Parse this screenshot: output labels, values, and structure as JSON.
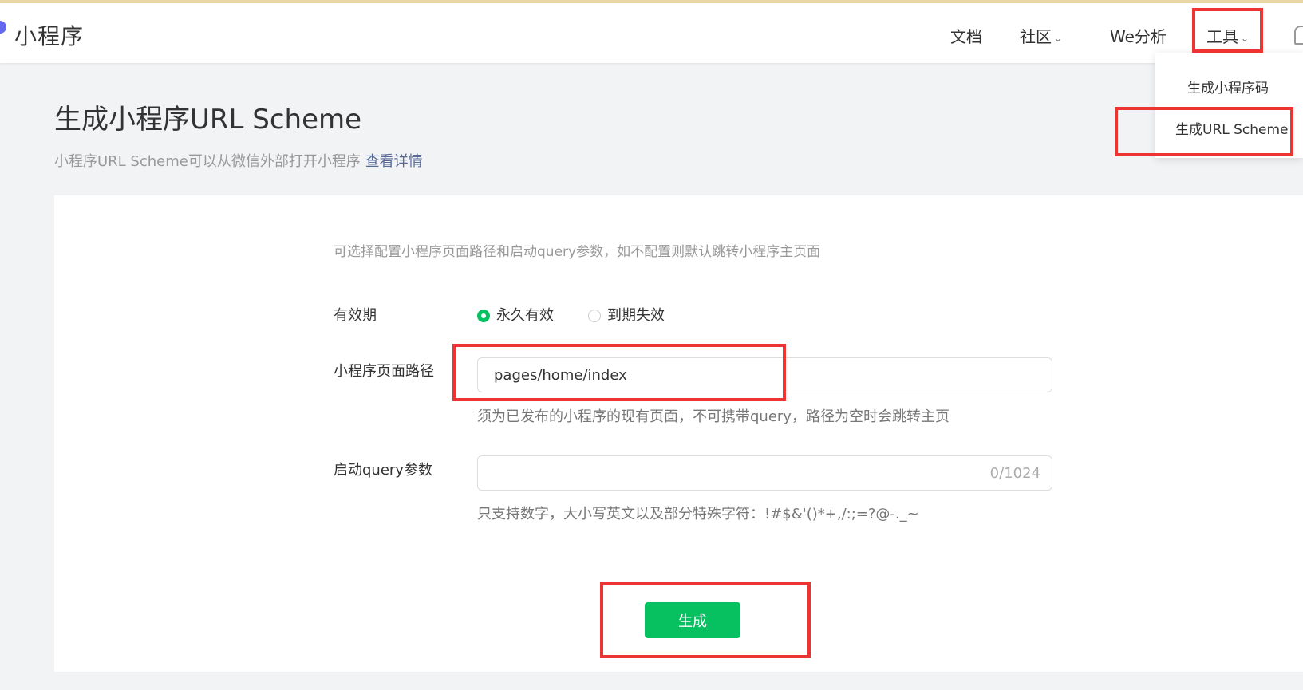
{
  "header": {
    "logo": "小程序",
    "nav": [
      {
        "label": "文档"
      },
      {
        "label": "社区"
      },
      {
        "label": "We分析"
      },
      {
        "label": "工具"
      }
    ]
  },
  "dropdown": {
    "items": [
      {
        "label": "生成小程序码"
      },
      {
        "label": "生成URL Scheme"
      }
    ]
  },
  "page": {
    "title": "生成小程序URL Scheme",
    "subtitle": "小程序URL Scheme可以从微信外部打开小程序",
    "subtitle_link": "查看详情"
  },
  "form": {
    "tip": "可选择配置小程序页面路径和启动query参数，如不配置则默认跳转小程序主页面",
    "validity": {
      "label": "有效期",
      "options": [
        {
          "label": "永久有效",
          "selected": true
        },
        {
          "label": "到期失效",
          "selected": false
        }
      ]
    },
    "path": {
      "label": "小程序页面路径",
      "value": "pages/home/index",
      "hint": "须为已发布的小程序的现有页面，不可携带query，路径为空时会跳转主页"
    },
    "query": {
      "label": "启动query参数",
      "value": "",
      "counter": "0/1024",
      "hint": "只支持数字，大小写英文以及部分特殊字符：!#$&'()*+,/:;=?@-._~"
    },
    "submit_label": "生成"
  },
  "colors": {
    "accent": "#07c160",
    "link": "#576b95",
    "highlight": "#ee3333"
  }
}
